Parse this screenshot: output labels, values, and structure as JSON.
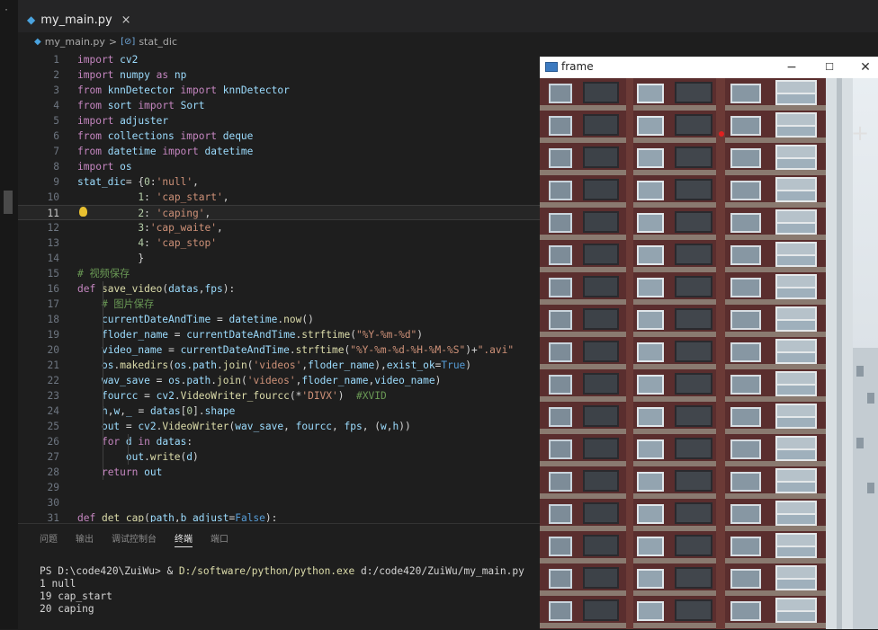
{
  "editor": {
    "tab_label": "my_main.py",
    "tab_close": "×",
    "breadcrumb": {
      "file": "my_main.py",
      "separator": ">",
      "symbol": "stat_dic"
    },
    "active_line": 11
  },
  "code_lines": [
    "import cv2",
    "import numpy as np",
    "from knnDetector import knnDetector",
    "from sort import Sort",
    "import adjuster",
    "from collections import deque",
    "from datetime import datetime",
    "import os",
    "stat_dic= {0:'null',",
    "          1: 'cap_start',",
    "          2: 'caping',",
    "          3:'cap_waite',",
    "          4: 'cap_stop'",
    "          }",
    "# 视频保存",
    "def save_video(datas,fps):",
    "    # 图片保存",
    "    currentDateAndTime = datetime.now()",
    "    floder_name = currentDateAndTime.strftime(\"%Y-%m-%d\")",
    "    video_name = currentDateAndTime.strftime(\"%Y-%m-%d-%H-%M-%S\")+\".avi\"",
    "    os.makedirs(os.path.join('videos',floder_name),exist_ok=True)",
    "    wav_save = os.path.join('videos',floder_name,video_name)",
    "    fourcc = cv2.VideoWriter_fourcc(*'DIVX')  #XVID",
    "    h,w,_ = datas[0].shape",
    "    out = cv2.VideoWriter(wav_save, fourcc, fps, (w,h))",
    "    for d in datas:",
    "        out.write(d)",
    "    return out",
    "",
    "",
    "def det_cap(path,b_adjust=False):"
  ],
  "panel": {
    "tabs": [
      "问题",
      "输出",
      "调试控制台",
      "终端",
      "端口"
    ],
    "active_tab": "终端",
    "terminal": {
      "prompt": "PS D:\\code420\\ZuiWu> & ",
      "exe": "D:/software/python/python.exe",
      "args": " d:/code420/ZuiWu/my_main.py",
      "output": [
        "1 null",
        "19 cap_start",
        "20 caping"
      ]
    }
  },
  "frame_window": {
    "title": "frame",
    "minimize": "−",
    "maximize": "☐",
    "close": "✕"
  },
  "colors": {
    "editor_bg": "#1e1e1e",
    "keyword": "#c586c0",
    "string": "#ce9178",
    "function": "#dcdcaa",
    "comment": "#6a9955",
    "building_wall": "#5a2e2e"
  },
  "cursor_glyph": "+"
}
